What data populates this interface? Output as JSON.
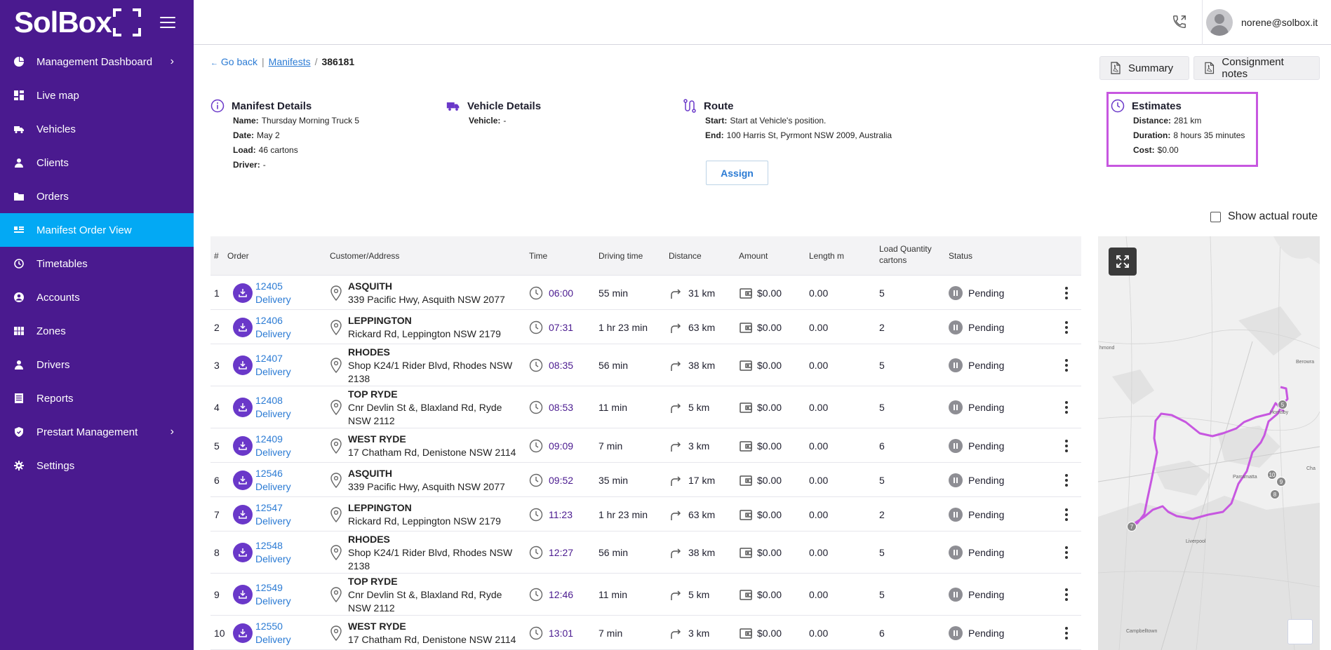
{
  "app": {
    "brand": "SolBox"
  },
  "sidebar": {
    "items": [
      {
        "label": "Management Dashboard",
        "icon": "pie-chart-icon",
        "chevron": "›",
        "active": false
      },
      {
        "label": "Live map",
        "icon": "dashboard-icon",
        "active": false
      },
      {
        "label": "Vehicles",
        "icon": "truck-icon",
        "active": false
      },
      {
        "label": "Clients",
        "icon": "person-icon",
        "active": false
      },
      {
        "label": "Orders",
        "icon": "folder-icon",
        "active": false
      },
      {
        "label": "Manifest Order View",
        "icon": "list-card-icon",
        "active": true
      },
      {
        "label": "Timetables",
        "icon": "clock-icon",
        "active": false
      },
      {
        "label": "Accounts",
        "icon": "account-circle-icon",
        "active": false
      },
      {
        "label": "Zones",
        "icon": "grid-icon",
        "active": false
      },
      {
        "label": "Drivers",
        "icon": "person-icon",
        "active": false
      },
      {
        "label": "Reports",
        "icon": "report-icon",
        "active": false
      },
      {
        "label": "Prestart Management",
        "icon": "shield-icon",
        "chevron": "›",
        "active": false
      },
      {
        "label": "Settings",
        "icon": "gear-icon",
        "active": false
      }
    ]
  },
  "topbar": {
    "user_email": "norene@solbox.it"
  },
  "breadcrumb": {
    "back": "Go back",
    "sep1": "|",
    "link": "Manifests",
    "sep2": "/",
    "current": "386181"
  },
  "buttons": {
    "summary": "Summary",
    "consignment": "Consignment notes",
    "assign": "Assign"
  },
  "manifest": {
    "title": "Manifest Details",
    "name_label": "Name:",
    "name": "Thursday Morning Truck 5",
    "date_label": "Date:",
    "date": "May 2",
    "load_label": "Load:",
    "load": "46  cartons",
    "driver_label": "Driver:",
    "driver": "-"
  },
  "vehicle": {
    "title": "Vehicle Details",
    "vehicle_label": "Vehicle:",
    "vehicle": "-"
  },
  "route": {
    "title": "Route",
    "start_label": "Start:",
    "start": "Start at Vehicle's position.",
    "end_label": "End:",
    "end": "100 Harris St, Pyrmont NSW 2009, Australia"
  },
  "estimates": {
    "title": "Estimates",
    "distance_label": "Distance:",
    "distance": "281 km",
    "duration_label": "Duration:",
    "duration": "8 hours 35 minutes",
    "cost_label": "Cost:",
    "cost": "$0.00"
  },
  "show_route_label": "Show actual route",
  "table": {
    "headers": {
      "num": "#",
      "order": "Order",
      "customer": "Customer/Address",
      "time": "Time",
      "driving": "Driving time",
      "distance": "Distance",
      "amount": "Amount",
      "length": "Length m",
      "load1": "Load Quantity",
      "load2": "cartons",
      "status": "Status"
    },
    "rows": [
      {
        "n": "1",
        "order": "12405",
        "type": "Delivery",
        "name": "ASQUITH",
        "addr1": "339 Pacific Hwy, Asquith NSW 2077",
        "addr2": "",
        "time": "06:00",
        "drive": "55 min",
        "dist": "31 km",
        "amount": "$0.00",
        "length": "0.00",
        "load": "5",
        "status": "Pending"
      },
      {
        "n": "2",
        "order": "12406",
        "type": "Delivery",
        "name": "LEPPINGTON",
        "addr1": "Rickard Rd, Leppington NSW 2179",
        "addr2": "",
        "time": "07:31",
        "drive": "1 hr 23 min",
        "dist": "63 km",
        "amount": "$0.00",
        "length": "0.00",
        "load": "2",
        "status": "Pending"
      },
      {
        "n": "3",
        "order": "12407",
        "type": "Delivery",
        "name": "RHODES",
        "addr1": "Shop K24/1 Rider Blvd, Rhodes NSW",
        "addr2": "2138",
        "time": "08:35",
        "drive": "56 min",
        "dist": "38 km",
        "amount": "$0.00",
        "length": "0.00",
        "load": "5",
        "status": "Pending"
      },
      {
        "n": "4",
        "order": "12408",
        "type": "Delivery",
        "name": "TOP RYDE",
        "addr1": "Cnr Devlin St &, Blaxland Rd, Ryde",
        "addr2": "NSW 2112",
        "time": "08:53",
        "drive": "11 min",
        "dist": "5 km",
        "amount": "$0.00",
        "length": "0.00",
        "load": "5",
        "status": "Pending"
      },
      {
        "n": "5",
        "order": "12409",
        "type": "Delivery",
        "name": "WEST RYDE",
        "addr1": "17 Chatham Rd, Denistone NSW 2114",
        "addr2": "",
        "time": "09:09",
        "drive": "7 min",
        "dist": "3 km",
        "amount": "$0.00",
        "length": "0.00",
        "load": "6",
        "status": "Pending"
      },
      {
        "n": "6",
        "order": "12546",
        "type": "Delivery",
        "name": "ASQUITH",
        "addr1": "339 Pacific Hwy, Asquith NSW 2077",
        "addr2": "",
        "time": "09:52",
        "drive": "35 min",
        "dist": "17 km",
        "amount": "$0.00",
        "length": "0.00",
        "load": "5",
        "status": "Pending"
      },
      {
        "n": "7",
        "order": "12547",
        "type": "Delivery",
        "name": "LEPPINGTON",
        "addr1": "Rickard Rd, Leppington NSW 2179",
        "addr2": "",
        "time": "11:23",
        "drive": "1 hr 23 min",
        "dist": "63 km",
        "amount": "$0.00",
        "length": "0.00",
        "load": "2",
        "status": "Pending"
      },
      {
        "n": "8",
        "order": "12548",
        "type": "Delivery",
        "name": "RHODES",
        "addr1": "Shop K24/1 Rider Blvd, Rhodes NSW",
        "addr2": "2138",
        "time": "12:27",
        "drive": "56 min",
        "dist": "38 km",
        "amount": "$0.00",
        "length": "0.00",
        "load": "5",
        "status": "Pending"
      },
      {
        "n": "9",
        "order": "12549",
        "type": "Delivery",
        "name": "TOP RYDE",
        "addr1": "Cnr Devlin St &, Blaxland Rd, Ryde",
        "addr2": "NSW 2112",
        "time": "12:46",
        "drive": "11 min",
        "dist": "5 km",
        "amount": "$0.00",
        "length": "0.00",
        "load": "5",
        "status": "Pending"
      },
      {
        "n": "10",
        "order": "12550",
        "type": "Delivery",
        "name": "WEST RYDE",
        "addr1": "17 Chatham Rd, Denistone NSW 2114",
        "addr2": "",
        "time": "13:01",
        "drive": "7 min",
        "dist": "3 km",
        "amount": "$0.00",
        "length": "0.00",
        "load": "6",
        "status": "Pending"
      }
    ]
  },
  "map": {
    "labels": [
      "hmond",
      "Berowra",
      "Hornsby",
      "Parramatta",
      "Liverpool",
      "Campbelltown",
      "Cha"
    ],
    "markers": [
      "5",
      "10",
      "9",
      "8",
      "7"
    ]
  },
  "colors": {
    "sidebar": "#4a1a8f",
    "active": "#03a9f4",
    "accent": "#6a38c9",
    "link": "#2b7bd4",
    "route": "#c757e0"
  }
}
